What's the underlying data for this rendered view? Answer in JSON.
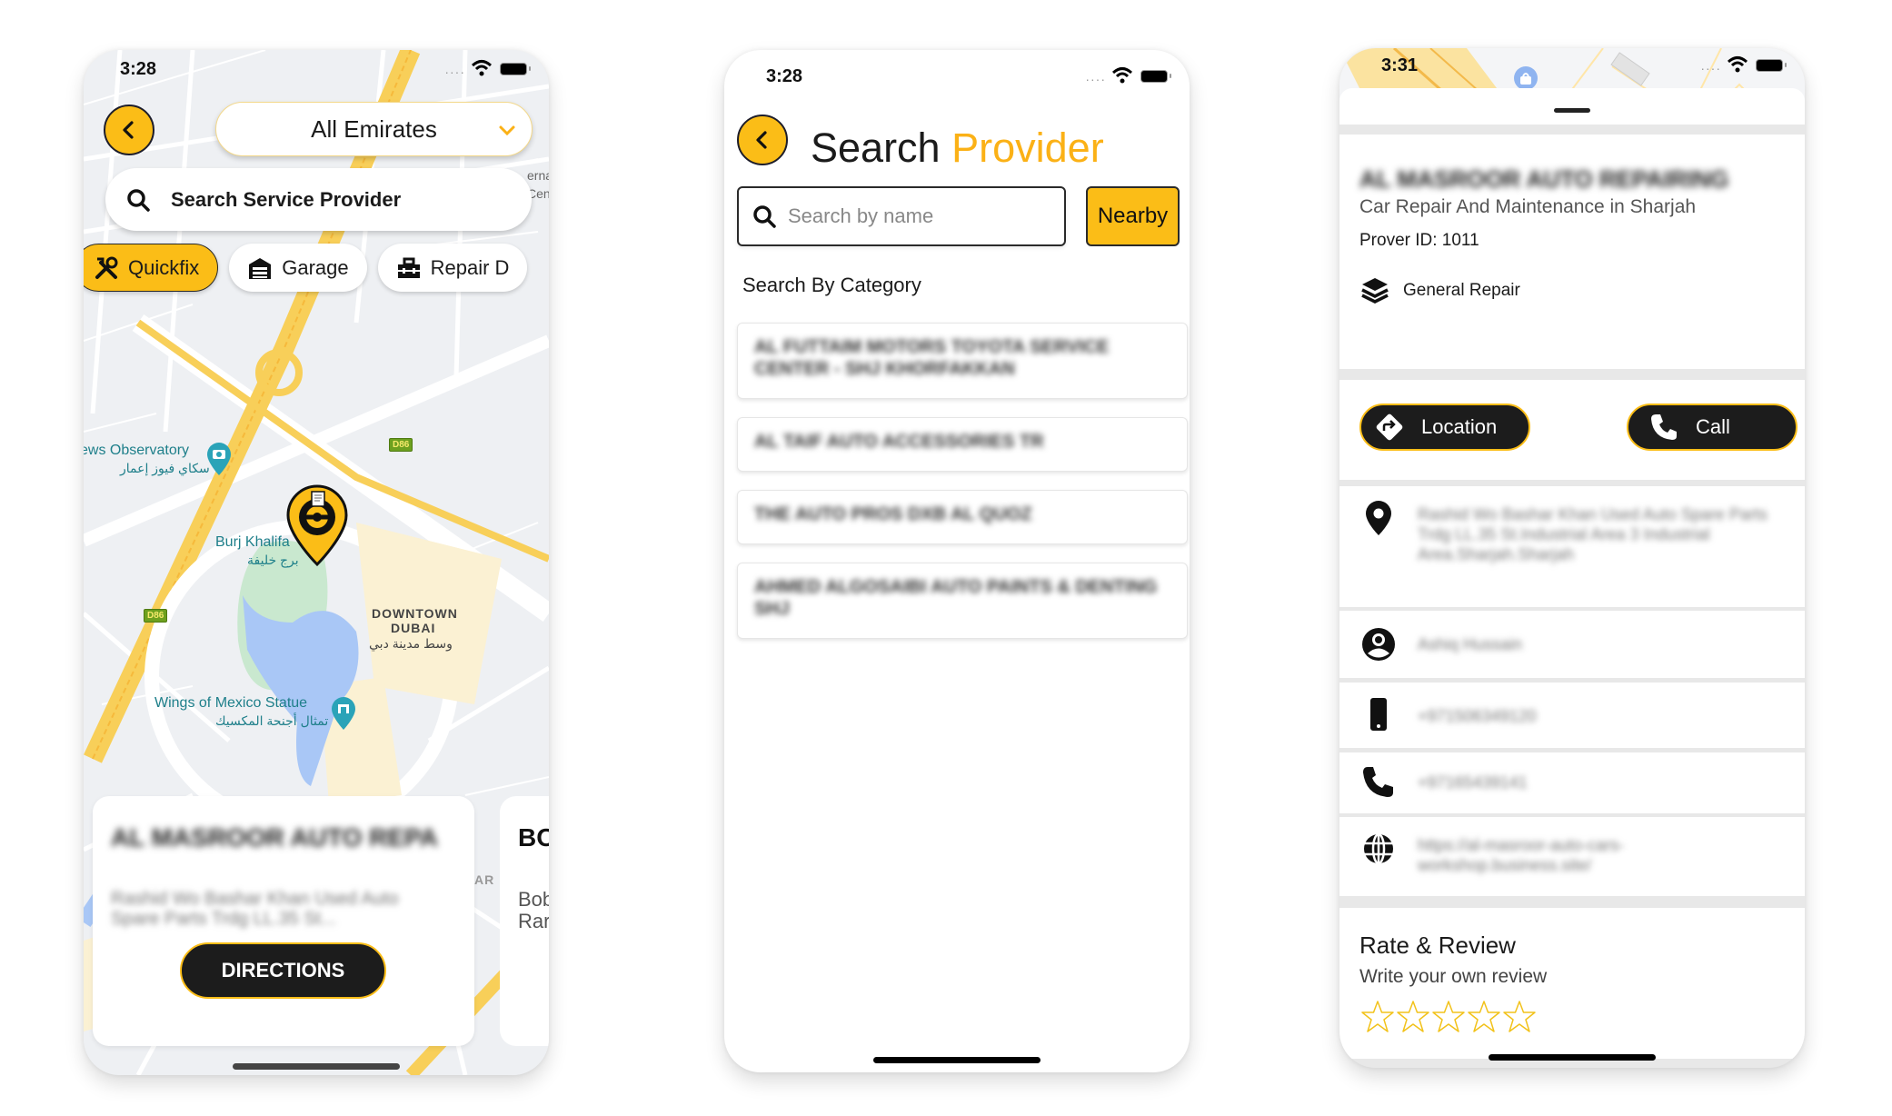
{
  "colors": {
    "accent": "#fbbd17",
    "dark": "#1c1c1c",
    "title_accent": "#fbb116"
  },
  "screens": [
    {
      "name": "map-screen",
      "status": {
        "time": "3:28"
      },
      "emirate_select": {
        "value": "All Emirates"
      },
      "search": {
        "label": "Search Service Provider"
      },
      "categories": [
        {
          "label": "Quickfix",
          "icon": "tools-icon",
          "active": true
        },
        {
          "label": "Garage",
          "icon": "garage-icon",
          "active": false
        },
        {
          "label": "Repair D",
          "icon": "toolbox-icon",
          "active": false
        }
      ],
      "map_labels": {
        "observatory": "ews Observatory",
        "observatory_ar": "سكاي فيوز إعمار",
        "burj": "Burj Khalifa",
        "burj_ar": "برج خليفة",
        "downtown_1": "DOWNTOWN",
        "downtown_2": "DUBAI",
        "downtown_ar": "وسط مدينة دبي",
        "wings": "Wings of Mexico Statue",
        "wings_ar": "تمثال أجنحة المكسيك",
        "road_1": "D86",
        "road_2": "D86",
        "partial_right_1": "erna",
        "partial_right_2": "Cen",
        "ar_mark": "AR"
      },
      "cards": [
        {
          "name": "AL MASROOR AUTO REPA",
          "address": "Rashid Wo Bashar Khan Used Auto Spare Parts Trdg LL.35 St...",
          "directions_label": "DIRECTIONS"
        },
        {
          "name": "BO",
          "address": "Bob\nRar"
        }
      ]
    },
    {
      "name": "search-provider-screen",
      "status": {
        "time": "3:28"
      },
      "title_part1": "Search",
      "title_part2": "Provider",
      "search": {
        "placeholder": "Search by name",
        "value": ""
      },
      "nearby_label": "Nearby",
      "category_label": "Search By Category",
      "results": [
        "AL FUTTAIM MOTORS TOYOTA SERVICE CENTER - SHJ KHORFAKKAN",
        "AL TAIF AUTO ACCESSORIES TR",
        "THE AUTO PROS DXB AL QUOZ",
        "AHMED ALGOSAIBI AUTO PAINTS & DENTING SHJ"
      ]
    },
    {
      "name": "provider-detail-screen",
      "status": {
        "time": "3:31"
      },
      "provider": {
        "name": "AL MASROOR AUTO REPAIRING",
        "subtitle": "Car Repair And Maintenance in Sharjah",
        "id_label": "Prover ID: 1011",
        "category": "General Repair"
      },
      "actions": {
        "location_label": "Location",
        "call_label": "Call"
      },
      "info": {
        "address": "Rashid Wo Bashar Khan Used Auto Spare Parts Trdg LL.35 St.Industrial Area 3 Industrial Area.Sharjah.Sharjah",
        "contact_name": "Ashiq Hussain",
        "mobile": "+971506349120",
        "phone": "+97165439141",
        "website": "https://al-masroor-auto-cars-workshop.business.site/"
      },
      "review": {
        "title": "Rate & Review",
        "subtitle": "Write your own review",
        "rating": 0,
        "max_rating": 5
      }
    }
  ]
}
